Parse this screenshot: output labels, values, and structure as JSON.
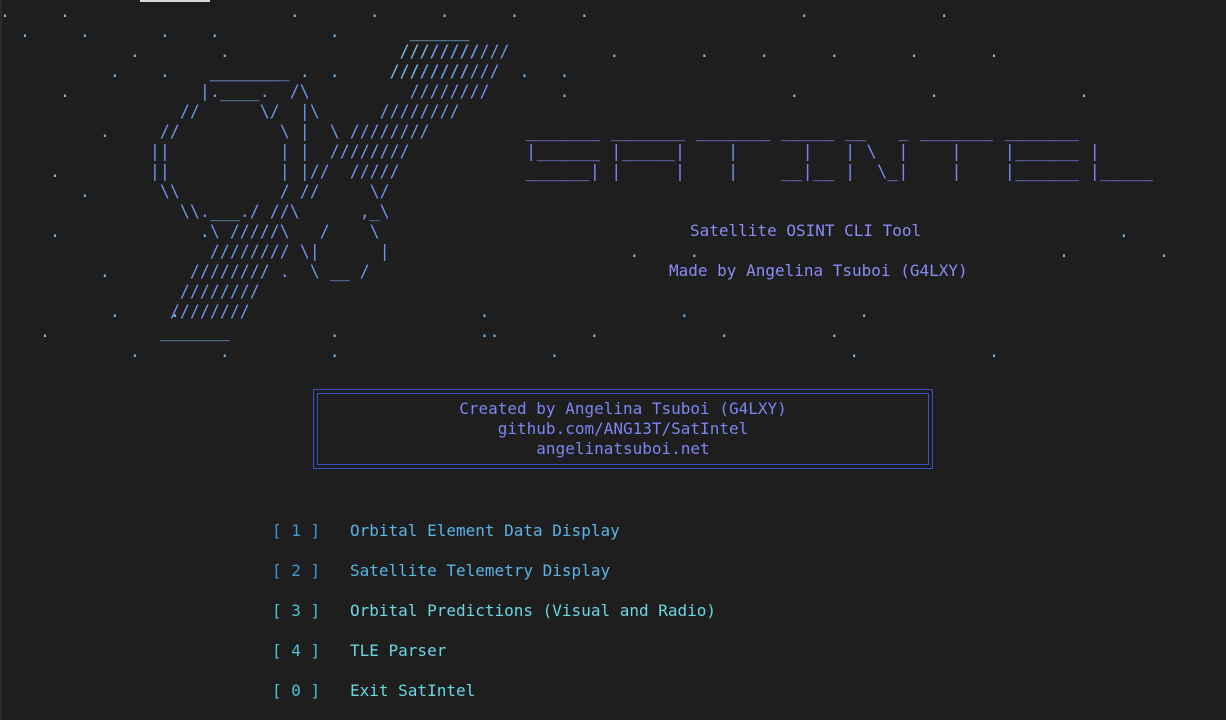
{
  "ascii": {
    "stars": ".     .                      .       .      .      .      .                     .             .\n  .     .       .    .           .       ______\n             .        .                 ////////             .        .     .      .       .       .\n           .    .    _______  .  .     ////////     .   .\n      .                                                 .                      .             .              .\n\n          .\n\n     .\n        .\n\n     .              .                                                                                           .\n                                                               .     .                                    .         .\n          .\n\n           .     .                              .                   .                 .\n    .                            .              ..         .            .          .\n             .        .          .                     .                             .             .",
    "logo": "\n\n                                       ////////\n                 ________             ////////\n                |.____.  /\\          ////////\n              //      \\/  |\\      ////////\n            //          \\ |  \\ ////////\n           ||           | |  ////////\n           ||           | |//  /////\n            \\\\          / //     \\/\n              \\\\.___./ //\\      ,_\\\n                 \\ /////\\   /    \\\n                 //////// \\|      |\n               //////// .  \\ __ /\n              ////////\n             ////////\n            _______",
    "title": "_______ _______ _______ _____ __   _ _______ _______\n|______ |_____|    |      |   | \\  |    |    |______ |\n______| |     |    |    __|__ |  \\_|    |    |______ |_____"
  },
  "tagline": {
    "line1": "Satellite OSINT CLI Tool",
    "line2": "Made by Angelina Tsuboi (G4LXY)"
  },
  "credits": {
    "line1": "Created by Angelina Tsuboi (G4LXY)",
    "line2": "github.com/ANG13T/SatIntel",
    "line3": "angelinatsuboi.net"
  },
  "menu": [
    {
      "key": "[ 1 ]",
      "label": "Orbital Element Data Display"
    },
    {
      "key": "[ 2 ]",
      "label": "Satellite Telemetry Display"
    },
    {
      "key": "[ 3 ]",
      "label": "Orbital Predictions (Visual and Radio)"
    },
    {
      "key": "[ 4 ]",
      "label": "TLE Parser"
    },
    {
      "key": "[ 0 ]",
      "label": "Exit SatIntel"
    }
  ],
  "colors": {
    "background": "#1e1e1e",
    "logo": "#6f94e6",
    "stars": "#79b8e6",
    "title": "#7b86f2",
    "box_border": "#3b4fc7",
    "menu_blue": "#5ab4e6",
    "menu_cyan": "#6ad7e2"
  }
}
